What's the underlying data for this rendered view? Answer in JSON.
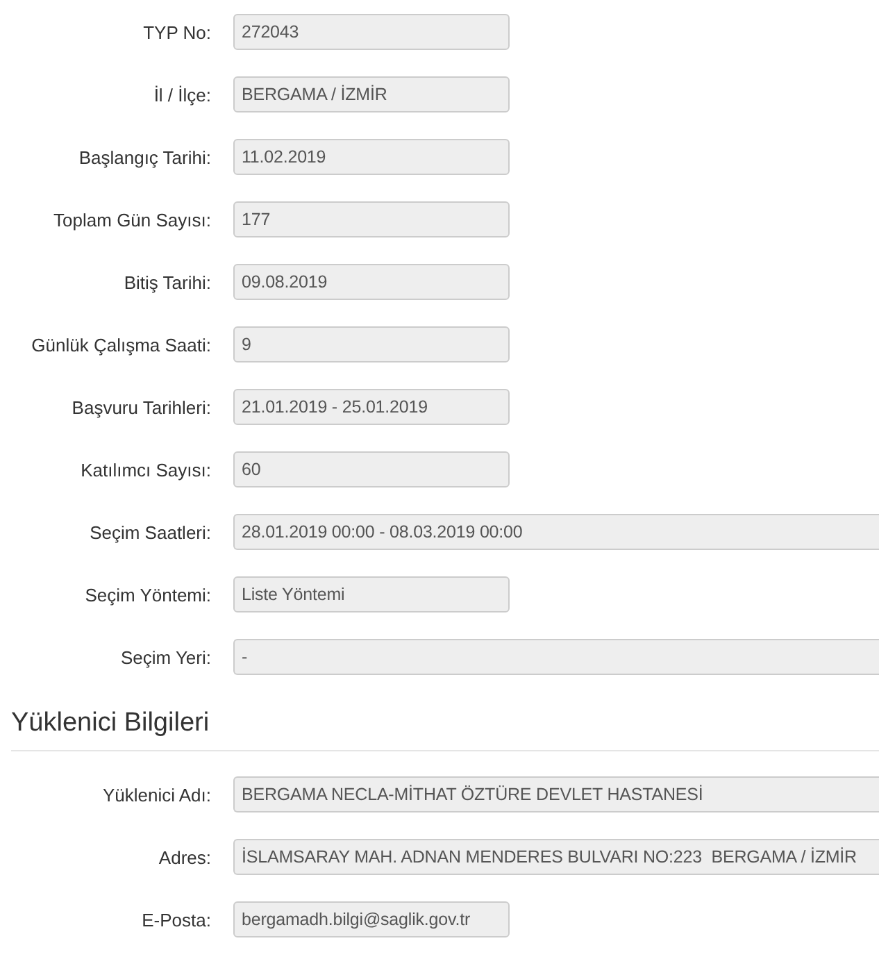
{
  "fields": [
    {
      "label": "TYP No:",
      "value": "272043",
      "kind": "short"
    },
    {
      "label": "İl / İlçe:",
      "value": "BERGAMA / İZMİR",
      "kind": "short"
    },
    {
      "label": "Başlangıç Tarihi:",
      "value": "11.02.2019",
      "kind": "short"
    },
    {
      "label": "Toplam Gün Sayısı:",
      "value": "177",
      "kind": "short"
    },
    {
      "label": "Bitiş Tarihi:",
      "value": "09.08.2019",
      "kind": "short"
    },
    {
      "label": "Günlük Çalışma Saati:",
      "value": "9",
      "kind": "short"
    },
    {
      "label": "Başvuru Tarihleri:",
      "value": "21.01.2019 - 25.01.2019",
      "kind": "short"
    },
    {
      "label": "Katılımcı Sayısı:",
      "value": "60",
      "kind": "short"
    },
    {
      "label": "Seçim Saatleri:",
      "value": "28.01.2019 00:00 - 08.03.2019 00:00",
      "kind": "wide"
    },
    {
      "label": "Seçim Yöntemi:",
      "value": "Liste Yöntemi",
      "kind": "short"
    },
    {
      "label": "Seçim Yeri:",
      "value": "-",
      "kind": "wide"
    }
  ],
  "contractor_section": {
    "title": "Yüklenici Bilgileri",
    "fields": [
      {
        "label": "Yüklenici Adı:",
        "value": "BERGAMA NECLA-MİTHAT ÖZTÜRE DEVLET HASTANESİ",
        "kind": "wide"
      },
      {
        "label": "Adres:",
        "value": "İSLAMSARAY MAH. ADNAN MENDERES BULVARI NO:223  BERGAMA / İZMİR",
        "kind": "wide"
      },
      {
        "label": "E-Posta:",
        "value": "bergamadh.bilgi@saglik.gov.tr",
        "kind": "short"
      }
    ]
  }
}
